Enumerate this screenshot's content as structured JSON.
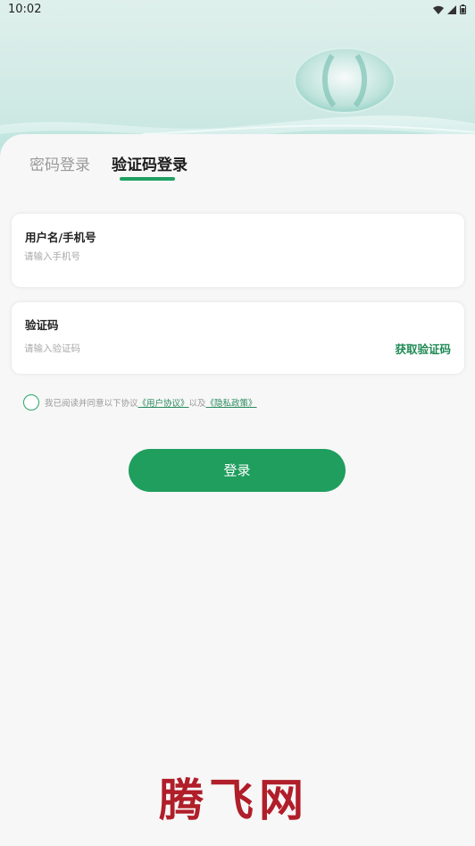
{
  "status_bar": {
    "time": "10:02"
  },
  "tabs": [
    {
      "label": "密码登录",
      "active": false
    },
    {
      "label": "验证码登录",
      "active": true
    }
  ],
  "form": {
    "username": {
      "label": "用户名/手机号",
      "placeholder": "请输入手机号",
      "value": ""
    },
    "code": {
      "label": "验证码",
      "placeholder": "请输入验证码",
      "value": "",
      "get_code_label": "获取验证码"
    }
  },
  "agreement": {
    "checked": false,
    "prefix": "我已阅读并同意以下协议",
    "user_agreement": "《用户协议》",
    "connector": "以及",
    "privacy_policy": "《隐私政策》"
  },
  "login_button": "登录",
  "watermark": "腾飞网",
  "colors": {
    "accent": "#1f9e5e",
    "tab_indicator": "#21a062",
    "header": "#cfe9e4",
    "watermark": "#b01e2a"
  }
}
